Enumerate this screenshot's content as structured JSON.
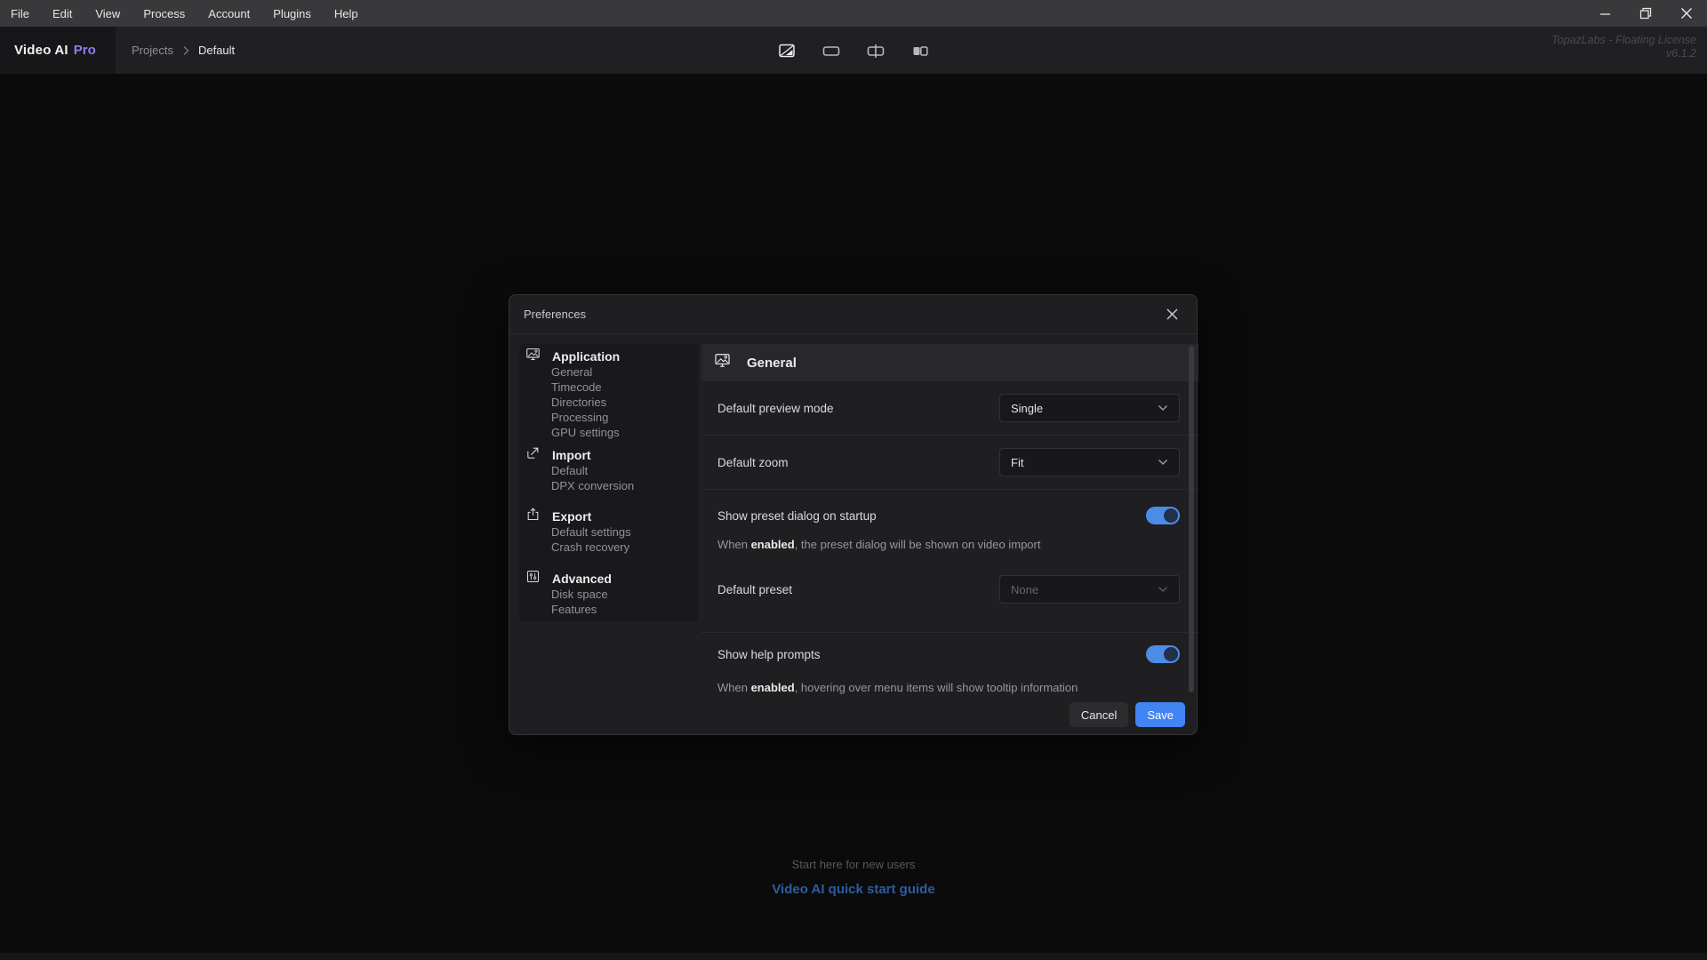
{
  "menu_bar": {
    "items": [
      "File",
      "Edit",
      "View",
      "Process",
      "Account",
      "Plugins",
      "Help"
    ]
  },
  "header": {
    "app_name": "Video AI",
    "app_badge": "Pro",
    "breadcrumb": [
      "Projects",
      "Default"
    ],
    "license_line1": "TopazLabs - Floating License",
    "license_line2": "v6.1.2"
  },
  "preview_toolbar": {
    "modes": [
      "diagonal-compare",
      "single-view",
      "split-view",
      "side-by-side-view"
    ],
    "active": "diagonal-compare"
  },
  "dialog": {
    "title": "Preferences",
    "sidebar": {
      "sections": [
        {
          "icon": "application-icon",
          "label": "Application",
          "items": [
            "General",
            "Timecode",
            "Directories",
            "Processing",
            "GPU settings"
          ]
        },
        {
          "icon": "import-icon",
          "label": "Import",
          "items": [
            "Default",
            "DPX conversion"
          ]
        },
        {
          "icon": "export-icon",
          "label": "Export",
          "items": [
            "Default settings",
            "Crash recovery"
          ]
        },
        {
          "icon": "advanced-icon",
          "label": "Advanced",
          "items": [
            "Disk space",
            "Features"
          ]
        }
      ]
    },
    "content": {
      "section_title": "General",
      "default_preview_mode": {
        "label": "Default preview mode",
        "value": "Single"
      },
      "default_zoom": {
        "label": "Default zoom",
        "value": "Fit"
      },
      "show_preset_dialog": {
        "label": "Show preset dialog on startup",
        "enabled": true,
        "desc_prefix": "When ",
        "desc_bold": "enabled",
        "desc_suffix": ", the preset dialog will be shown on video import"
      },
      "default_preset": {
        "label": "Default preset",
        "value": "None",
        "disabled": true
      },
      "show_help_prompts": {
        "label": "Show help prompts",
        "enabled": true,
        "desc_prefix": "When ",
        "desc_bold": "enabled",
        "desc_suffix": ", hovering over menu items will show tooltip information"
      }
    },
    "footer": {
      "cancel_label": "Cancel",
      "save_label": "Save"
    }
  },
  "empty_state": {
    "hint": "Start here for new users",
    "link_label": "Video AI quick start guide"
  },
  "colors": {
    "accent_blue": "#4184f2",
    "toggle_track": "#4c8ce8",
    "badge_purple": "#9579f0",
    "link_blue": "#2e5c9c"
  }
}
